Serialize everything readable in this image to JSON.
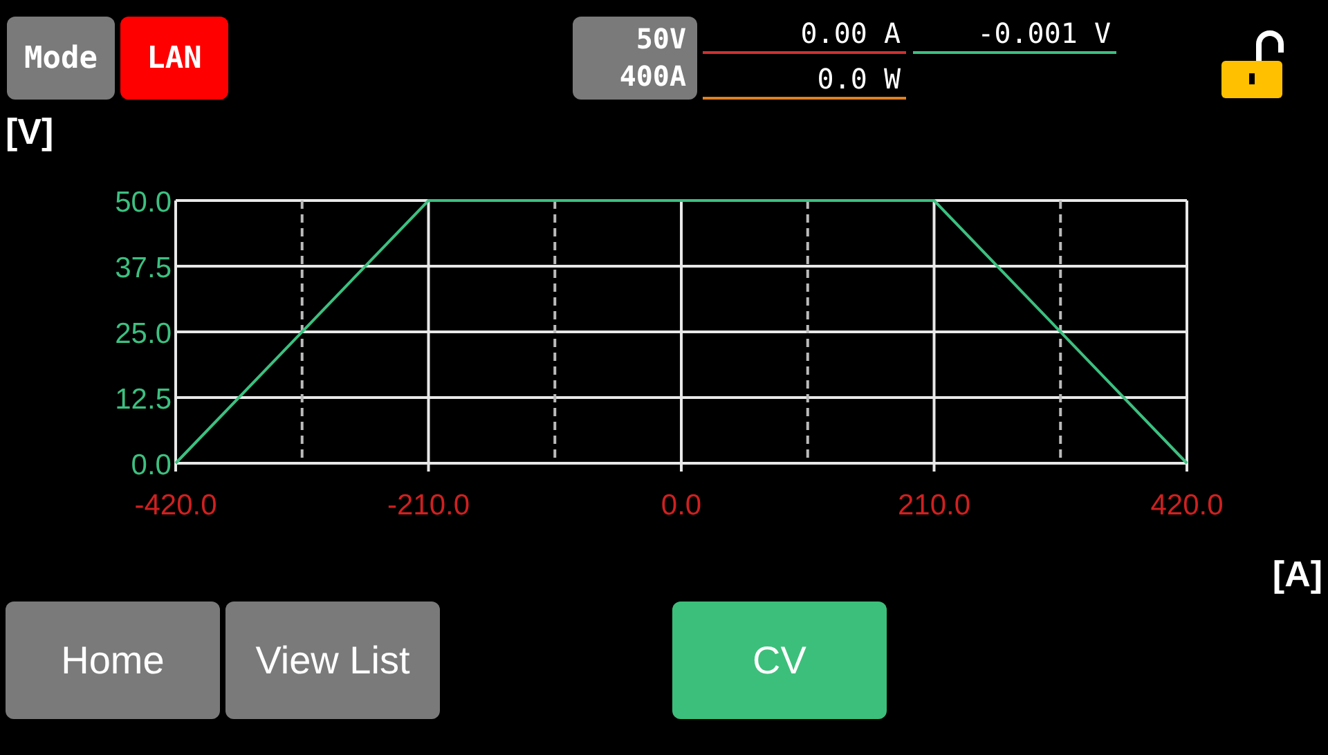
{
  "header": {
    "mode_button": "Mode",
    "interface_badge": "LAN",
    "range": {
      "voltage": "50V",
      "current": "400A"
    },
    "readings": [
      {
        "value": "0.00",
        "unit": "A",
        "color": "#d03030"
      },
      {
        "value": "-0.001",
        "unit": "V",
        "color": "#3cc080"
      },
      {
        "value": "0.0",
        "unit": "W",
        "color": "#e08020"
      }
    ],
    "lock": {
      "locked": false
    }
  },
  "chart": {
    "chart_data": {
      "type": "line",
      "xlabel": "[A]",
      "ylabel": "[V]",
      "x": [
        -420,
        -210,
        210,
        420
      ],
      "series": [
        {
          "color": "#3cc080",
          "values": [
            0,
            50,
            50,
            0
          ]
        }
      ],
      "grid": true,
      "xlim": [
        -420,
        420
      ],
      "ylim": [
        0,
        50
      ],
      "xticks": [
        {
          "value": -420,
          "label": "-420.0"
        },
        {
          "value": -210,
          "label": "-210.0"
        },
        {
          "value": 0,
          "label": "0.0"
        },
        {
          "value": 210,
          "label": "210.0"
        },
        {
          "value": 420,
          "label": "420.0"
        }
      ],
      "yticks": [
        {
          "value": 0,
          "label": "0.0"
        },
        {
          "value": 12.5,
          "label": "12.5"
        },
        {
          "value": 25,
          "label": "25.0"
        },
        {
          "value": 37.5,
          "label": "37.5"
        },
        {
          "value": 50,
          "label": "50.0"
        }
      ]
    }
  },
  "buttons": [
    {
      "label": "Home",
      "kind": "nav"
    },
    {
      "label": "View List",
      "kind": "nav"
    },
    {
      "label": "CV",
      "kind": "mode"
    }
  ]
}
